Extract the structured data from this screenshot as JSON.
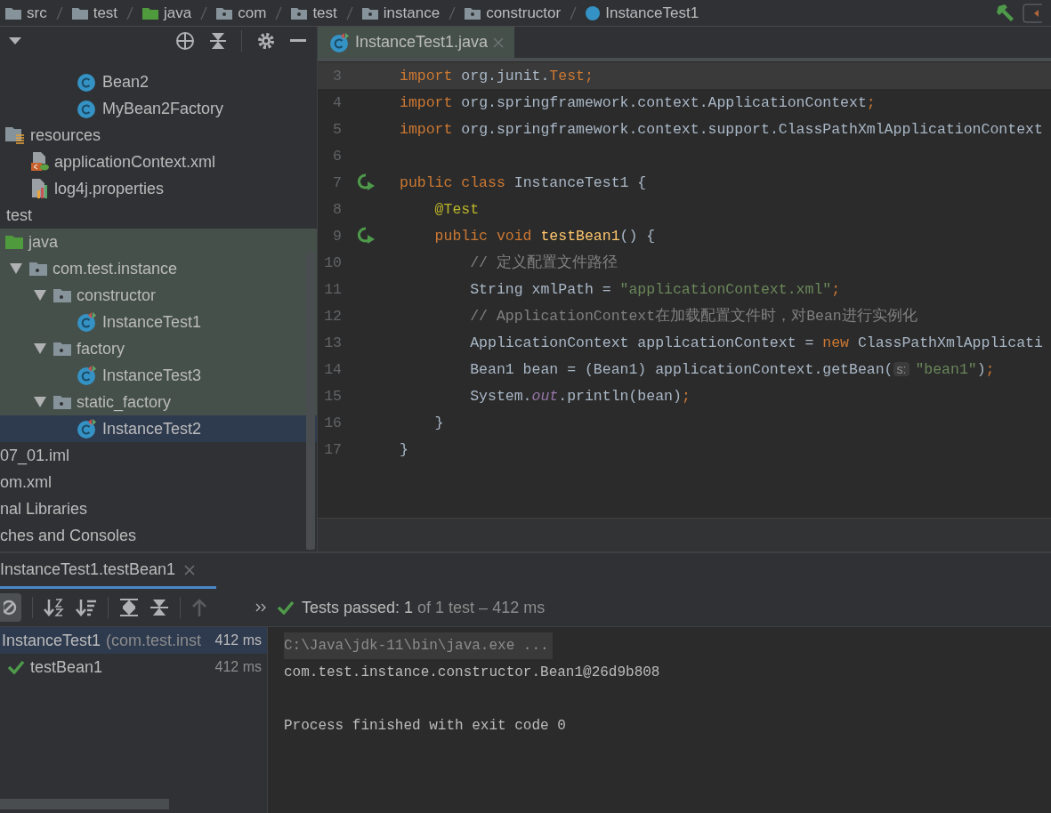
{
  "breadcrumb": [
    {
      "label": "src",
      "kind": "folder"
    },
    {
      "label": "test",
      "kind": "folder"
    },
    {
      "label": "java",
      "kind": "source"
    },
    {
      "label": "com",
      "kind": "package"
    },
    {
      "label": "test",
      "kind": "package"
    },
    {
      "label": "instance",
      "kind": "package"
    },
    {
      "label": "constructor",
      "kind": "package"
    },
    {
      "label": "InstanceTest1",
      "kind": "class"
    }
  ],
  "project_tree": [
    {
      "children": [
        {
          "children": [
            {
              "children": [
                {
                  "children": [
                    {
                      "label": "Bean2",
                      "kind": "class",
                      "selected": false,
                      "highlighted": false
                    },
                    {
                      "label": "MyBean2Factory",
                      "kind": "class",
                      "selected": false,
                      "highlighted": false
                    }
                  ]
                }
              ]
            }
          ]
        },
        {
          "label": "resources",
          "kind": "resources",
          "selected": false,
          "highlighted": false,
          "children": [
            {
              "label": "applicationContext.xml",
              "kind": "xml",
              "selected": false,
              "highlighted": false
            },
            {
              "label": "log4j.properties",
              "kind": "properties",
              "selected": false,
              "highlighted": false
            }
          ]
        }
      ]
    },
    {
      "label": "test",
      "kind": "none",
      "selected": false,
      "highlighted": false,
      "children": [
        {
          "label": "java",
          "kind": "source",
          "selected": false,
          "highlighted": true,
          "children": [
            {
              "label": "com.test.instance",
              "kind": "package",
              "expanded": true,
              "selected": false,
              "highlighted": true,
              "children": [
                {
                  "label": "constructor",
                  "kind": "package",
                  "expanded": true,
                  "selected": false,
                  "highlighted": true,
                  "children": [
                    {
                      "label": "InstanceTest1",
                      "kind": "test-class",
                      "selected": false,
                      "highlighted": true
                    }
                  ]
                },
                {
                  "label": "factory",
                  "kind": "package",
                  "expanded": true,
                  "selected": false,
                  "highlighted": true,
                  "children": [
                    {
                      "label": "InstanceTest3",
                      "kind": "test-class",
                      "selected": false,
                      "highlighted": true
                    }
                  ]
                },
                {
                  "label": "static_factory",
                  "kind": "package",
                  "expanded": true,
                  "selected": false,
                  "highlighted": true,
                  "children": [
                    {
                      "label": "InstanceTest2",
                      "kind": "test-class",
                      "selected": true,
                      "highlighted": false
                    }
                  ]
                }
              ]
            }
          ]
        }
      ]
    },
    {
      "label": "07_01.iml",
      "kind": "none",
      "selected": false,
      "highlighted": false
    },
    {
      "label": "om.xml",
      "kind": "none",
      "selected": false,
      "highlighted": false
    },
    {
      "label": "nal Libraries",
      "kind": "none",
      "selected": false,
      "highlighted": false
    },
    {
      "label": "ches and Consoles",
      "kind": "none",
      "selected": false,
      "highlighted": false
    }
  ],
  "editor": {
    "tab": {
      "label": "InstanceTest1.java",
      "selected": true
    },
    "lines": [
      {
        "number": "3",
        "current": true,
        "runnable": false,
        "tokens": [
          {
            "text": "import",
            "kind": "kw"
          },
          {
            "text": " org.junit.",
            "kind": "plain"
          },
          {
            "text": "Test;",
            "kind": "kw"
          }
        ]
      },
      {
        "number": "4",
        "current": false,
        "runnable": false,
        "tokens": [
          {
            "text": "import",
            "kind": "kw"
          },
          {
            "text": " org.springframework.context.ApplicationContext",
            "kind": "plain"
          },
          {
            "text": ";",
            "kind": "kw"
          }
        ]
      },
      {
        "number": "5",
        "current": false,
        "runnable": false,
        "tokens": [
          {
            "text": "import",
            "kind": "kw"
          },
          {
            "text": " org.springframework.context.support.ClassPathXmlApplicationContext",
            "kind": "plain"
          }
        ]
      },
      {
        "number": "6",
        "current": false,
        "runnable": false
      },
      {
        "number": "7",
        "current": false,
        "runnable": true,
        "tokens": [
          {
            "text": "public class",
            "kind": "kw"
          },
          {
            "text": " InstanceTest1 {",
            "kind": "plain"
          }
        ]
      },
      {
        "number": "8",
        "current": false,
        "runnable": false,
        "tokens": [
          {
            "text": "    @Test",
            "kind": "ann"
          }
        ]
      },
      {
        "number": "9",
        "current": false,
        "runnable": true,
        "tokens": [
          {
            "text": "    public void ",
            "kind": "kw"
          },
          {
            "text": "testBean1",
            "kind": "method"
          },
          {
            "text": "() {",
            "kind": "plain"
          }
        ]
      },
      {
        "number": "10",
        "current": false,
        "runnable": false,
        "tokens": [
          {
            "text": "        // 定义配置文件路径",
            "kind": "comment"
          }
        ]
      },
      {
        "number": "11",
        "current": false,
        "runnable": false,
        "tokens": [
          {
            "text": "        String xmlPath = ",
            "kind": "plain"
          },
          {
            "text": "\"applicationContext.xml\"",
            "kind": "str"
          },
          {
            "text": ";",
            "kind": "kw"
          }
        ]
      },
      {
        "number": "12",
        "current": false,
        "runnable": false,
        "tokens": [
          {
            "text": "        // ApplicationContext在加载配置文件时，对Bean进行实例化",
            "kind": "comment"
          }
        ]
      },
      {
        "number": "13",
        "current": false,
        "runnable": false,
        "tokens": [
          {
            "text": "        ApplicationContext applicationContext = ",
            "kind": "plain"
          },
          {
            "text": "new",
            "kind": "kw"
          },
          {
            "text": " ClassPathXmlApplicati",
            "kind": "plain"
          }
        ]
      },
      {
        "number": "14",
        "current": false,
        "runnable": false,
        "tokens": [
          {
            "text": "        Bean1 bean = (Bean1) applicationContext.getBean(",
            "kind": "plain"
          },
          {
            "text": "s:",
            "kind": "hint"
          },
          {
            "text": "\"bean1\"",
            "kind": "str"
          },
          {
            "text": ")",
            "kind": "plain"
          },
          {
            "text": ";",
            "kind": "kw"
          }
        ]
      },
      {
        "number": "15",
        "current": false,
        "runnable": false,
        "tokens": [
          {
            "text": "        System.",
            "kind": "plain"
          },
          {
            "text": "out",
            "kind": "field"
          },
          {
            "text": ".println(bean)",
            "kind": "plain"
          },
          {
            "text": ";",
            "kind": "kw"
          }
        ]
      },
      {
        "number": "16",
        "current": false,
        "runnable": false,
        "tokens": [
          {
            "text": "    }",
            "kind": "plain"
          }
        ]
      },
      {
        "number": "17",
        "current": false,
        "runnable": false,
        "tokens": [
          {
            "text": "}",
            "kind": "plain"
          }
        ]
      }
    ]
  },
  "run_panel": {
    "tab": {
      "label": "InstanceTest1.testBean1",
      "selected": true
    },
    "status": {
      "strong": "Tests passed: 1",
      "rest": "of 1 test – 412 ms"
    },
    "tests": [
      {
        "name": "InstanceTest1",
        "detail": "(com.test.inst",
        "time": "412 ms",
        "selected": true,
        "children": [
          {
            "name": "testBean1",
            "time": "412 ms",
            "kind": "passed",
            "selected": false
          }
        ]
      }
    ],
    "console": [
      {
        "text": "C:\\Java\\jdk-11\\bin\\java.exe ...",
        "kind": "command"
      },
      {
        "text": "com.test.instance.constructor.Bean1@26d9b808",
        "kind": "output"
      },
      {
        "text": "Process finished with exit code 0",
        "kind": "exit"
      }
    ]
  }
}
